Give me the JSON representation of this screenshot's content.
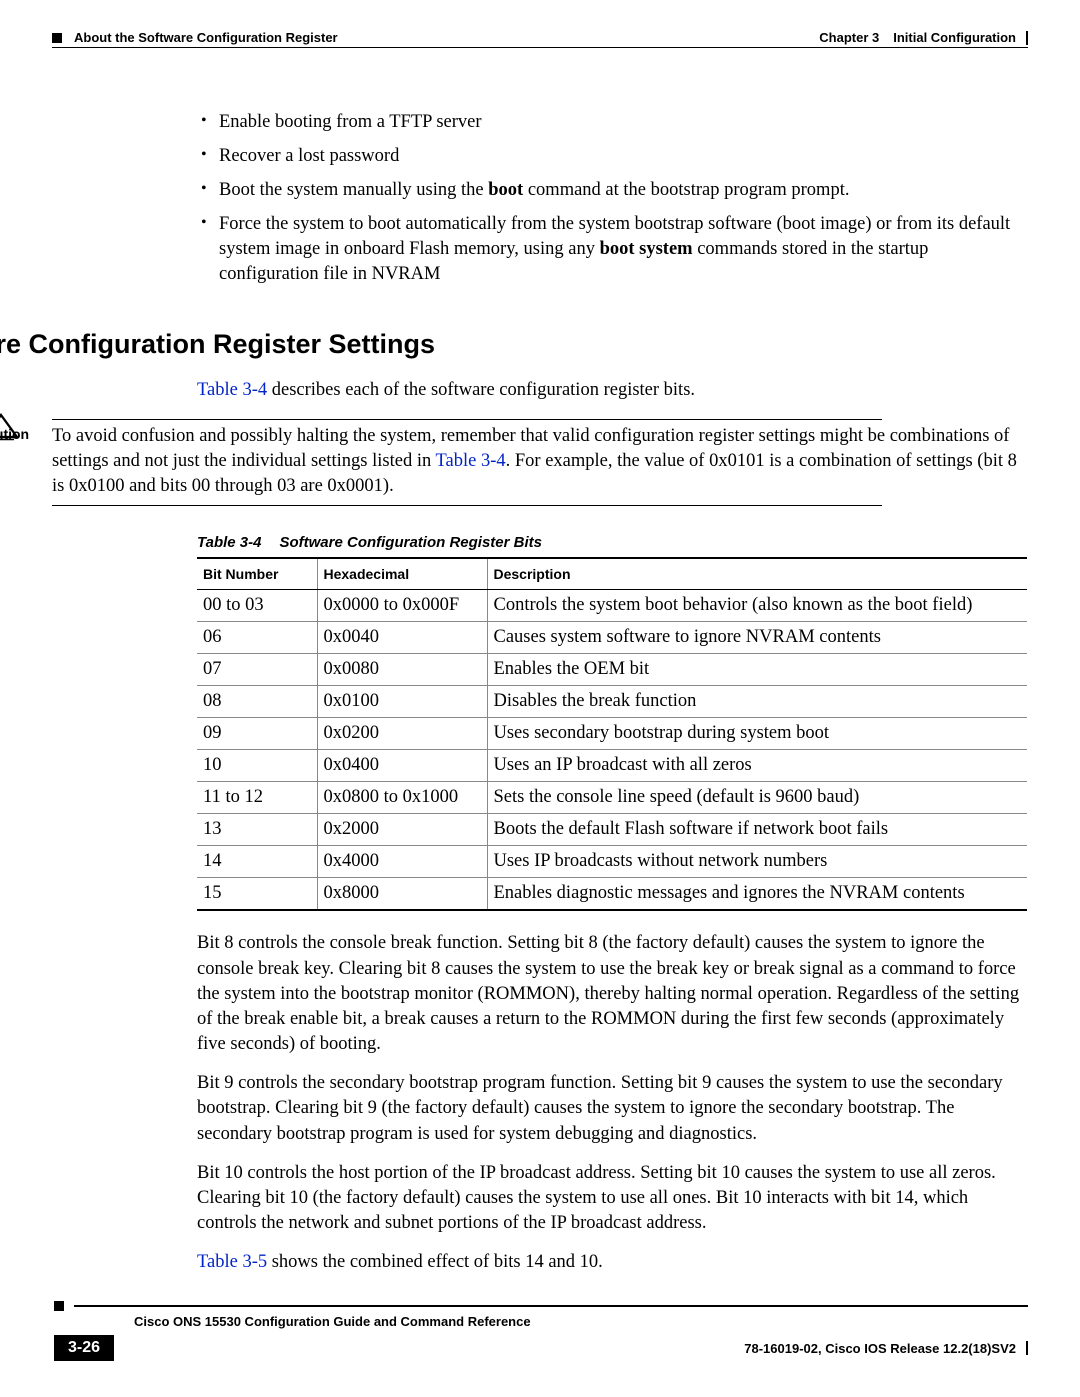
{
  "header": {
    "chapter": "Chapter 3",
    "chapter_title": "Initial Configuration",
    "section": "About the Software Configuration Register"
  },
  "bullets": [
    {
      "text": "Enable booting from a TFTP server"
    },
    {
      "text": "Recover a lost password"
    },
    {
      "prefix": "Boot the system manually using the ",
      "bold": "boot",
      "suffix": " command at the bootstrap program prompt."
    },
    {
      "prefix": "Force the system to boot automatically from the system bootstrap software (boot image) or from its default system image in onboard Flash memory, using any ",
      "bold": "boot system",
      "suffix": " commands stored in the startup configuration file in NVRAM"
    }
  ],
  "heading": "Software Configuration Register Settings",
  "intro": {
    "link": "Table 3-4",
    "rest": " describes each of the software configuration register bits."
  },
  "caution": {
    "label": "Caution",
    "t1": "To avoid confusion and possibly halting the system, remember that valid configuration register settings might be combinations of settings and not just the individual settings listed in ",
    "link": "Table 3-4",
    "t2": ". For example, the value of 0x0101 is a combination of settings (bit 8 is 0x0100 and bits 00 through 03 are 0x0001)."
  },
  "table": {
    "caption_no": "Table 3-4",
    "caption_title": "Software Configuration Register Bits",
    "cols": [
      "Bit Number",
      "Hexadecimal",
      "Description"
    ],
    "rows": [
      [
        "00 to 03",
        "0x0000 to 0x000F",
        "Controls the system boot behavior (also known as the boot field)"
      ],
      [
        "06",
        "0x0040",
        "Causes system software to ignore NVRAM contents"
      ],
      [
        "07",
        "0x0080",
        "Enables the OEM bit"
      ],
      [
        "08",
        "0x0100",
        "Disables the break function"
      ],
      [
        "09",
        "0x0200",
        "Uses secondary bootstrap during system boot"
      ],
      [
        "10",
        "0x0400",
        "Uses an IP broadcast with all zeros"
      ],
      [
        "11 to 12",
        "0x0800 to 0x1000",
        "Sets the console line speed (default is 9600 baud)"
      ],
      [
        "13",
        "0x2000",
        "Boots the default Flash software if network boot fails"
      ],
      [
        "14",
        "0x4000",
        "Uses IP broadcasts without network numbers"
      ],
      [
        "15",
        "0x8000",
        "Enables diagnostic messages and ignores the NVRAM contents"
      ]
    ]
  },
  "para1": "Bit 8 controls the console break function. Setting bit 8 (the factory default) causes the system to ignore the console break key. Clearing bit 8 causes the system to use the break key or break signal as a command to force the system into the bootstrap monitor (ROMMON), thereby halting normal operation. Regardless of the setting of the break enable bit, a break causes a return to the ROMMON during the first few seconds (approximately five seconds) of booting.",
  "para2": "Bit 9 controls the secondary bootstrap program function. Setting bit 9 causes the system to use the secondary bootstrap. Clearing bit 9 (the factory default) causes the system to ignore the secondary bootstrap. The secondary bootstrap program is used for system debugging and diagnostics.",
  "para3": "Bit 10 controls the host portion of the IP broadcast address. Setting bit 10 causes the system to use all zeros. Clearing bit 10 (the factory default) causes the system to use all ones. Bit 10 interacts with bit 14, which controls the network and subnet portions of the IP broadcast address.",
  "para4": {
    "link": "Table 3-5",
    "rest": " shows the combined effect of bits 14 and 10."
  },
  "footer": {
    "title": "Cisco ONS 15530 Configuration Guide and Command Reference",
    "pagenum": "3-26",
    "meta": "78-16019-02, Cisco IOS Release 12.2(18)SV2"
  }
}
